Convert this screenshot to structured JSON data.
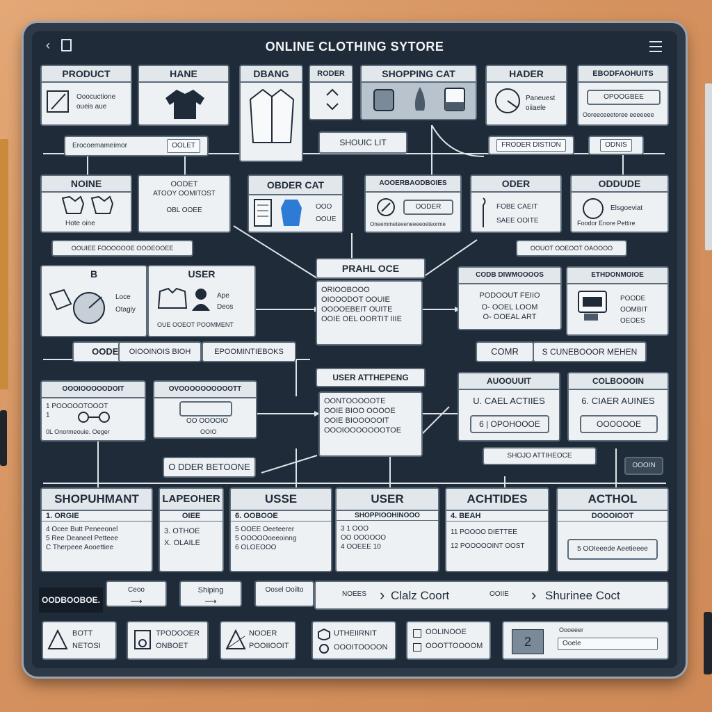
{
  "app": {
    "title": "ONLINE CLOTHING SYTORE"
  },
  "row1": {
    "product": {
      "title": "PRODUCT",
      "l1": "Ooocuctione",
      "l2": "oueis aue"
    },
    "name": {
      "title": "HANE"
    },
    "design": {
      "title": "DBANG"
    },
    "order": {
      "title": "RODER"
    },
    "cart": {
      "title": "SHOPPING CAT"
    },
    "header": {
      "title": "HADER",
      "l1": "Paneuest",
      "l2": "oiiaele"
    },
    "bookmarks": {
      "title": "EBODFAOHUITS",
      "btn": "OPOOGBEE",
      "l1": "Ooreeceeetoree eeeeeee"
    }
  },
  "strip1": {
    "field": "Erocoemameimor",
    "btn": "OOLET",
    "list": "SHOUIC LIT",
    "prod": "FRODER DISTION",
    "btn2": "ODNIS"
  },
  "row2": {
    "home": {
      "title": "NOINE",
      "l1": "Hote oine"
    },
    "order_an": {
      "l1": "OODET",
      "l2": "ATOOY OOMITOST",
      "l3": "OBL OOEE"
    },
    "order_cart": {
      "title": "OBDER CAT",
      "l1": "OOO",
      "l2": "OOUE"
    },
    "accessories": {
      "title": "AOOERBAODBOIES",
      "btn": "OODER",
      "l1": "Oneemmeteeeneeeeoeteorme"
    },
    "order": {
      "title": "ODER",
      "l1": "FOBE CAEIT",
      "l2": "SAEE OOITE"
    },
    "ordude": {
      "title": "ODDUDE",
      "l1": "Elsgoeviat",
      "l2": "Foodor Enore Pettire"
    }
  },
  "strip2": {
    "left": "OOUIEE FOOOOOOE OOOEOOEE",
    "right": "OOUOT OOEOOT OAOOOO"
  },
  "center": {
    "prame": {
      "title": "PRAHL OCE",
      "items": [
        "ORIOOBOOO",
        "OIOOODOT OOUIE",
        "OOOOEBEIT OUITE",
        "OOIE OEL OORTIT IIIE"
      ]
    },
    "user_att": {
      "title": "USER ATTHEPENG",
      "items": [
        "OONTOOOOOTE",
        "OOIE BIOO OOOOE",
        "OOIE BIOOOOOIT",
        "OOOIOOOOOOOTOE"
      ]
    }
  },
  "row3": {
    "b": {
      "title": "B",
      "l1": "Loce",
      "l2": "Otagiy"
    },
    "user": {
      "title": "USER",
      "l1": "Ape",
      "l2": "Deos",
      "l3": "OUE OOEOT POOMMENT"
    },
    "codd": {
      "title": "CODB DIWMOOOOS",
      "l1": "PODOOUT FEIIO",
      "l2": "O- OOEL LOOM",
      "l3": "O- OOEAL ART"
    },
    "ethd": {
      "title": "ETHDONMOIOE",
      "l1": "POODE",
      "l2": "OOMBIT",
      "l3": "OEOES"
    }
  },
  "strip3": {
    "t1": "OODER",
    "t2": "OIOOINOIS BIOH",
    "t3": "EPOOMINTIEBOKS",
    "t4": "COMR",
    "t5": "S CUNEBOOOR MEHEN"
  },
  "row4": {
    "orderis": {
      "title": "OOOIOOOOODOIT",
      "l1": "1 POOOOOTOOOT",
      "l2": "1",
      "l3": "0L Onormeouie. Oeger"
    },
    "ovoq": {
      "title": "OVOOOOOOOOOOTT",
      "l1": "OO OOOOIO",
      "l2": "OOIO"
    },
    "border": "O DDER BETOONE",
    "aboout": {
      "title": "AUOOUUIT",
      "l1": "U. CAEL ACTIIES",
      "l2": "6 | OPOHOOOE"
    },
    "colld": {
      "title": "COLBOOOIN",
      "l1": "6. CIAER AUINES",
      "l2": "OOOOOOE"
    },
    "btn1": "SHOJO ATTIHEOCE",
    "btn2": "OOOIN"
  },
  "row5": [
    {
      "title": "SHOPUHMANT",
      "h": "1.  ORGIE",
      "items": [
        "4  Ocee Butt Peneeonel",
        "5  Ree Deaneel Petteee",
        "C  Therpeee Aooettiee"
      ]
    },
    {
      "title": "LAPEOHER",
      "h": "OIEE",
      "items": [
        "3.  OTHOE",
        "X.  OLAILE"
      ]
    },
    {
      "title": "USSE",
      "h": "6.  OOBOOE",
      "items": [
        "5  OOEE Oeeteerer",
        "5  OOOOOoeeoinng",
        "6  OLOEOOO"
      ]
    },
    {
      "title": "USER",
      "h": "SHOPPIOOHINOOO",
      "items": [
        "3  1 OOO",
        "  OO OOOOOO",
        "4  OOEEE 10"
      ]
    },
    {
      "title": "ACHTIDES",
      "h": "4.  BEAH",
      "items": [
        "11  POOOO DIETTEE",
        "12  POOOOOINT OOST"
      ]
    },
    {
      "title": "ACTHOL",
      "h": "DOOOIOOT",
      "items": [
        "5  OOIeeede Aeetieeee"
      ]
    }
  ],
  "nav": {
    "label": "OODBOOBOE.",
    "b1": "Ceoo",
    "b2": "Shiping",
    "b3": "Oosel Ooilto",
    "c1": "NOEES",
    "c1v": "Clalz Coort",
    "c2": "OOIIE",
    "c2v": "Shurinee Coct"
  },
  "footer": [
    {
      "l1": "BOTT",
      "l2": "NETOSI"
    },
    {
      "l1": "TPODOOER",
      "l2": "ONBOET"
    },
    {
      "l1": "NOOER",
      "l2": "POOIIOOIT"
    },
    {
      "l1": "UTHEIIRNIT",
      "l2": "OOOITOOOON"
    },
    {
      "l1": "OOLINOOE",
      "l2": "OOOTTOOOOM"
    }
  ],
  "footer_last": {
    "num": "2",
    "l1": "Oooeeer",
    "l2": "Ooele"
  }
}
